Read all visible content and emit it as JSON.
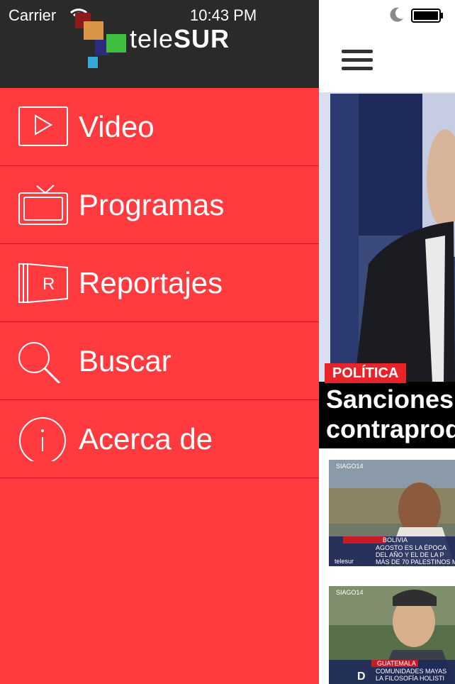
{
  "status_bar": {
    "carrier": "Carrier",
    "time": "10:43 PM"
  },
  "logo": {
    "part1": "tele",
    "part2": "SUR"
  },
  "menu": {
    "items": [
      {
        "label": "Video",
        "icon": "play-icon"
      },
      {
        "label": "Programas",
        "icon": "tv-icon"
      },
      {
        "label": "Reportajes",
        "icon": "reportajes-icon"
      },
      {
        "label": "Buscar",
        "icon": "search-icon"
      },
      {
        "label": "Acerca de",
        "icon": "info-icon"
      }
    ]
  },
  "featured": {
    "category": "POLÍTICA",
    "headline_line1": "Sanciones",
    "headline_line2": "contraprod"
  },
  "thumbnails": [
    {
      "date": "SIAGO14",
      "place": "BOLIVIA",
      "line1": "AGOSTO ES LA ÉPOCA",
      "line2": "DEL AÑO Y EL DE LA P",
      "line3": "MÁS DE 70 PALESTINOS M",
      "brand": "telesur"
    },
    {
      "date": "SIAGO14",
      "place": "GUATEMALA",
      "line1": "COMUNIDADES MAYAS",
      "line2": "LA FILOSOFÍA HOLISTI",
      "brand": "D"
    }
  ],
  "colors": {
    "drawer": "#ff3b3f",
    "header": "#2a2a2a",
    "badge": "#e8232a"
  }
}
